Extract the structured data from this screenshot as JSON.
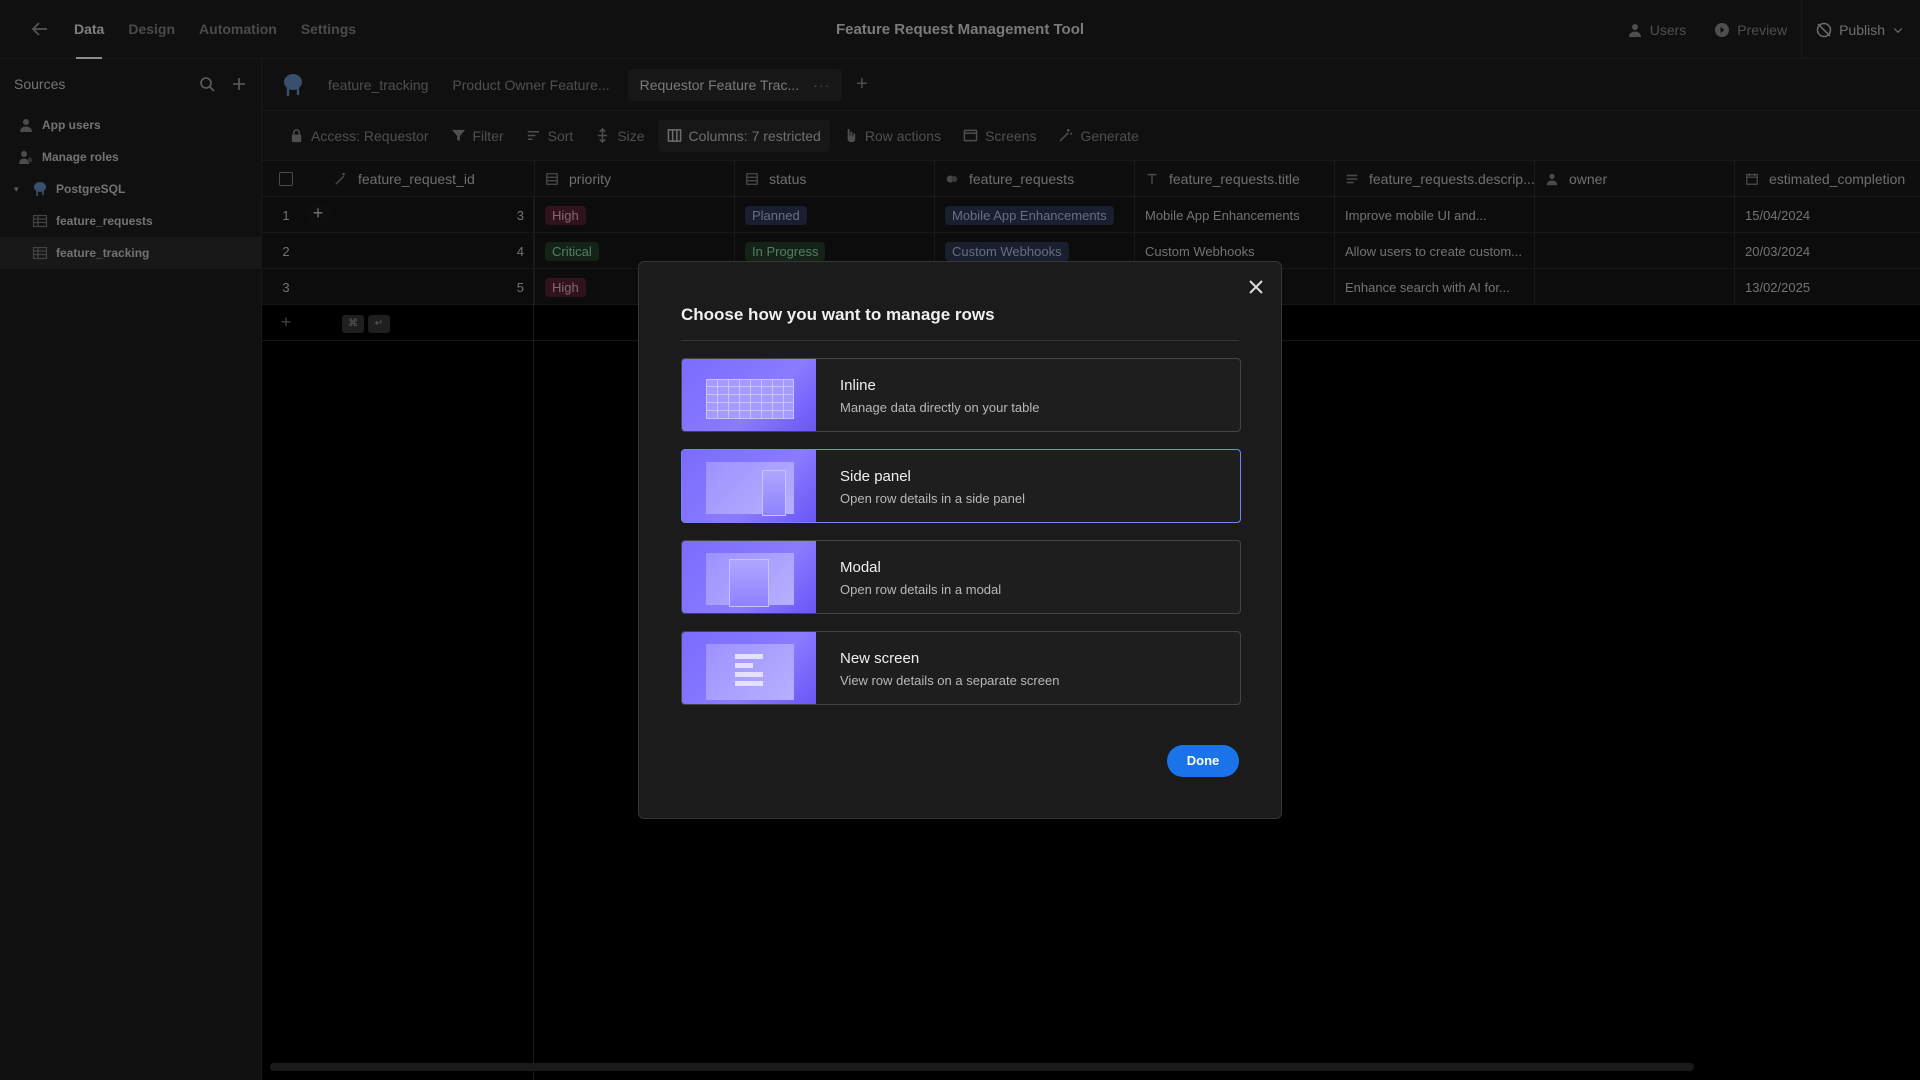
{
  "topbar": {
    "nav": [
      "Data",
      "Design",
      "Automation",
      "Settings"
    ],
    "title": "Feature Request Management Tool",
    "users_label": "Users",
    "preview_label": "Preview",
    "publish_label": "Publish"
  },
  "sidebar": {
    "title": "Sources",
    "items": [
      {
        "label": "App users",
        "icon": "user-icon"
      },
      {
        "label": "Manage roles",
        "icon": "roles-icon"
      },
      {
        "label": "PostgreSQL",
        "icon": "postgresql-icon"
      },
      {
        "label": "feature_requests",
        "icon": "table-icon"
      },
      {
        "label": "feature_tracking",
        "icon": "table-icon"
      }
    ]
  },
  "tabs": {
    "items": [
      "feature_tracking",
      "Product Owner Feature...",
      "Requestor Feature Trac..."
    ],
    "more": "···"
  },
  "toolbar": {
    "access": "Access: Requestor",
    "filter": "Filter",
    "sort": "Sort",
    "size": "Size",
    "columns": "Columns: 7 restricted",
    "row_actions": "Row actions",
    "screens": "Screens",
    "generate": "Generate"
  },
  "table": {
    "columns": [
      "feature_request_id",
      "priority",
      "status",
      "feature_requests",
      "feature_requests.title",
      "feature_requests.descrip...",
      "owner",
      "estimated_completion"
    ],
    "rows": [
      {
        "idx": "1",
        "id": "3",
        "priority": "High",
        "status": "Planned",
        "fr": "Mobile App Enhancements",
        "title": "Mobile App Enhancements",
        "desc": "Improve mobile UI and...",
        "owner": "",
        "est": "15/04/2024"
      },
      {
        "idx": "2",
        "id": "4",
        "priority": "Critical",
        "status": "In Progress",
        "fr": "Custom Webhooks",
        "title": "Custom Webhooks",
        "desc": "Allow users to create custom...",
        "owner": "",
        "est": "20/03/2024"
      },
      {
        "idx": "3",
        "id": "5",
        "priority": "High",
        "status": "",
        "fr": "",
        "title": "",
        "desc": "Enhance search with AI for...",
        "owner": "",
        "est": "13/02/2025"
      }
    ],
    "kbd": [
      "⌘",
      "↵"
    ]
  },
  "modal": {
    "title": "Choose how you want to manage rows",
    "options": [
      {
        "title": "Inline",
        "desc": "Manage data directly on your table"
      },
      {
        "title": "Side panel",
        "desc": "Open row details in a side panel"
      },
      {
        "title": "Modal",
        "desc": "Open row details in a modal"
      },
      {
        "title": "New screen",
        "desc": "View row details on a separate screen"
      }
    ],
    "selected": "Side panel",
    "done_label": "Done"
  },
  "colors": {
    "accent": "#1a73e8",
    "selected_border": "#6f86ff",
    "thumb": "#7b6cff"
  }
}
